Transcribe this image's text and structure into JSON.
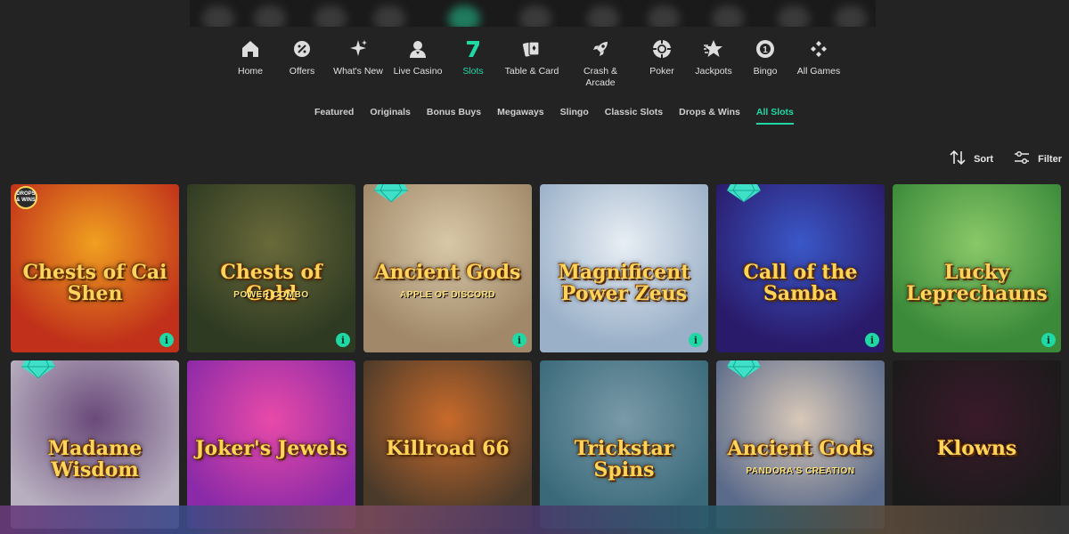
{
  "nav": {
    "items": [
      {
        "label": "Home",
        "icon": "home-icon"
      },
      {
        "label": "Offers",
        "icon": "percent-badge-icon"
      },
      {
        "label": "What's New",
        "icon": "sparkles-icon"
      },
      {
        "label": "Live Casino",
        "icon": "dealer-icon"
      },
      {
        "label": "Slots",
        "icon": "seven-icon"
      },
      {
        "label": "Table & Card",
        "icon": "playing-cards-icon"
      },
      {
        "label": "Crash &\nArcade",
        "icon": "rocket-icon"
      },
      {
        "label": "Poker",
        "icon": "poker-chip-icon"
      },
      {
        "label": "Jackpots",
        "icon": "star-icon"
      },
      {
        "label": "Bingo",
        "icon": "bingo-ball-icon"
      },
      {
        "label": "All Games",
        "icon": "grid-diamonds-icon"
      }
    ],
    "active_index": 4
  },
  "subnav": {
    "items": [
      "Featured",
      "Originals",
      "Bonus Buys",
      "Megaways",
      "Slingo",
      "Classic Slots",
      "Drops & Wins",
      "All Slots"
    ],
    "active_index": 7
  },
  "toolbar": {
    "sort_label": "Sort",
    "filter_label": "Filter"
  },
  "tiles": [
    {
      "title": "Chests of Cai Shen",
      "sub": "",
      "bg": [
        "#c0301a",
        "#f0a020"
      ],
      "gem": false,
      "badge": "DROPS & WINS",
      "info": true
    },
    {
      "title": "Chests of Gold",
      "sub": "POWER COMBO",
      "bg": [
        "#2e3a22",
        "#6a6a3a"
      ],
      "gem": false,
      "badge": "",
      "info": true
    },
    {
      "title": "Ancient Gods",
      "sub": "APPLE OF DISCORD",
      "bg": [
        "#a08868",
        "#d8c8a8"
      ],
      "gem": true,
      "badge": "",
      "info": true
    },
    {
      "title": "Magnificent Power Zeus",
      "sub": "",
      "bg": [
        "#9ab0c8",
        "#e8eef4"
      ],
      "gem": false,
      "badge": "",
      "info": true
    },
    {
      "title": "Call of the Samba",
      "sub": "",
      "bg": [
        "#2a1a6a",
        "#3a58c8"
      ],
      "gem": true,
      "badge": "",
      "info": true
    },
    {
      "title": "Lucky Leprechauns",
      "sub": "",
      "bg": [
        "#3a8a3a",
        "#8ac868"
      ],
      "gem": false,
      "badge": "",
      "info": true
    },
    {
      "title": "Madame Wisdom",
      "sub": "",
      "bg": [
        "#b8b0c0",
        "#6a4a7a"
      ],
      "gem": true,
      "badge": "",
      "info": false
    },
    {
      "title": "Joker's Jewels",
      "sub": "",
      "bg": [
        "#8a2aa8",
        "#e84aa8"
      ],
      "gem": false,
      "badge": "",
      "info": false
    },
    {
      "title": "Killroad 66",
      "sub": "",
      "bg": [
        "#4a3a2a",
        "#c86a2a"
      ],
      "gem": false,
      "badge": "",
      "info": false
    },
    {
      "title": "Trickstar Spins",
      "sub": "",
      "bg": [
        "#3a6a7a",
        "#7a9aa8"
      ],
      "gem": false,
      "badge": "",
      "info": false
    },
    {
      "title": "Ancient Gods",
      "sub": "PANDORA'S CREATION",
      "bg": [
        "#5a6a8a",
        "#d8c8b8"
      ],
      "gem": true,
      "badge": "",
      "info": false
    },
    {
      "title": "Klowns",
      "sub": "",
      "bg": [
        "#1a1a1a",
        "#3a1a2a"
      ],
      "gem": false,
      "badge": "",
      "info": false
    }
  ],
  "colors": {
    "accent": "#1fd8a4",
    "background": "#232323"
  }
}
